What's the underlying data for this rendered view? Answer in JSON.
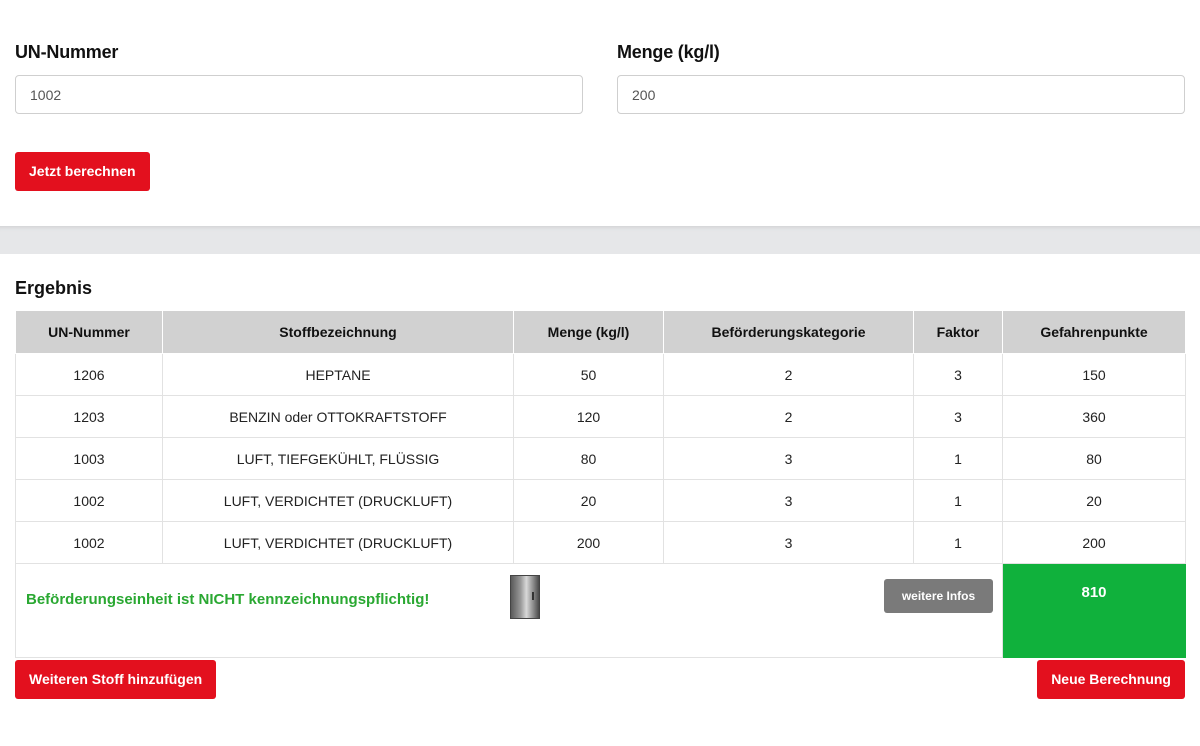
{
  "form": {
    "un_label": "UN-Nummer",
    "un_value": "1002",
    "qty_label": "Menge (kg/l)",
    "qty_value": "200",
    "calc_button": "Jetzt berechnen"
  },
  "result": {
    "title": "Ergebnis",
    "columns": [
      "UN-Nummer",
      "Stoffbezeichnung",
      "Menge (kg/l)",
      "Beförderungskategorie",
      "Faktor",
      "Gefahrenpunkte"
    ],
    "rows": [
      [
        "1206",
        "HEPTANE",
        "50",
        "2",
        "3",
        "150"
      ],
      [
        "1203",
        "BENZIN oder OTTOKRAFTSTOFF",
        "120",
        "2",
        "3",
        "360"
      ],
      [
        "1003",
        "LUFT, TIEFGEKÜHLT, FLÜSSIG",
        "80",
        "3",
        "1",
        "80"
      ],
      [
        "1002",
        "LUFT, VERDICHTET (DRUCKLUFT)",
        "20",
        "3",
        "1",
        "20"
      ],
      [
        "1002",
        "LUFT, VERDICHTET (DRUCKLUFT)",
        "200",
        "3",
        "1",
        "200"
      ]
    ],
    "summary_message": "Beförderungseinheit ist NICHT kennzeichnungspflichtig!",
    "summary_icon": "cabinet-icon",
    "info_button": "weitere Infos",
    "total": "810"
  },
  "actions": {
    "add_button": "Weiteren Stoff hinzufügen",
    "new_button": "Neue Berechnung"
  },
  "colors": {
    "primary_red": "#e3101e",
    "success_green": "#10b13c",
    "message_green": "#2aa832",
    "info_gray": "#7a7a7a",
    "header_gray": "#d1d1d1"
  }
}
